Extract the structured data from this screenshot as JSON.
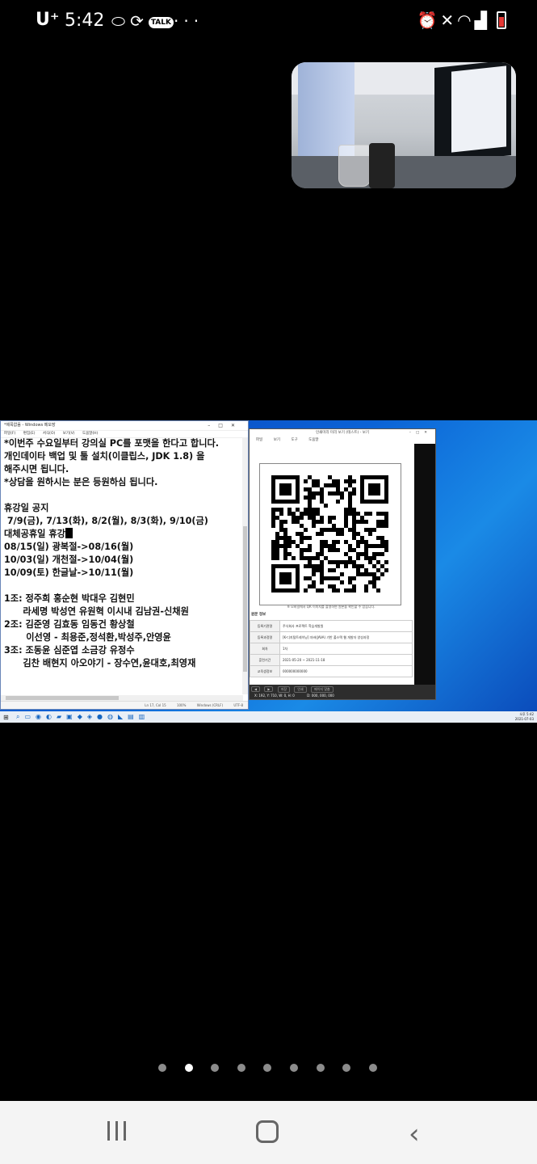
{
  "status_bar": {
    "carrier": "U⁺",
    "time": "5:42",
    "left_icons": [
      "pill-icon",
      "sync-icon",
      "talk-icon",
      "more-icon"
    ],
    "talk_label": "TALK",
    "more_label": "···",
    "right_icons": [
      "alarm-icon",
      "mute-icon",
      "wifi-icon",
      "signal-icon",
      "battery-icon"
    ]
  },
  "screen_share": {
    "notepad": {
      "title": "*제목없음 - Windows 메모장",
      "menu": [
        "파일(F)",
        "편집(E)",
        "서식(O)",
        "보기(V)",
        "도움말(H)"
      ],
      "lines": [
        "*이번주 수요일부터 강의실 PC를 포맷을 한다고 합니다.",
        "개인데이타 백업 및 툴 설치(이클립스, JDK 1.8) 을",
        "해주시면 됩니다.",
        "*상담을 원하시는 분은 등원하심 됩니다.",
        "",
        "휴강일 공지",
        " 7/9(금), 7/13(화), 8/2(월), 8/3(화), 9/10(금)",
        "대체공휴일 휴강",
        "08/15(일) 광복절->08/16(월)",
        "10/03(일) 개천절->10/04(월)",
        "10/09(토) 한글날->10/11(월)",
        "",
        "1조: 정주희 홍순현 박대우 김현민",
        "      라세명 박성연 유원혁 이시내 김남권-신채원",
        "2조: 김준영 김효동 임동건 황상철",
        "       이선영 - 최용준,정석환,박성주,안영윤",
        "3조: 조동윤 심준엽 소금강 유정수",
        "      김찬 배현지 아오야기 - 장수연,윤대호,최영재"
      ],
      "status": [
        "Ln 17, Col 15",
        "100%",
        "Windows (CRLF)",
        "UTF-8"
      ]
    },
    "viewer": {
      "title": "인쇄미리 미리 보기 (테스트) - 보기",
      "menu": [
        "파일",
        "보기",
        "도구",
        "도움말"
      ],
      "qr_caption": "※ 모바일에서 QR 이미지를 촬영하면 원본을 확인할 수 있습니다.",
      "info_title": "원문 정보",
      "table": [
        [
          "등록기관명",
          "주식회사 프로젝트 학습개발원"
        ],
        [
          "등록과정명",
          "[K-디지털트레이닝] 자바(JAVA) 기반 풀스택 웹 개발자 양성과정"
        ],
        [
          "회차",
          "1차"
        ],
        [
          "훈련기간",
          "2021-05-20 ~ 2021-11-18"
        ],
        [
          "교육생정보",
          "000000000000"
        ]
      ],
      "controls": [
        "◀",
        "▶",
        "저장",
        "인쇄",
        "페이지 맞춤"
      ],
      "coords": [
        "X: 192, Y: 710, W: 0, H: 0",
        "D: 000, 000, 000"
      ]
    },
    "taskbar_clock": [
      "오후 5:42",
      "2021-07-03"
    ]
  },
  "pager": {
    "count": 9,
    "active_index": 1
  },
  "nav": {
    "back_glyph": "‹"
  }
}
